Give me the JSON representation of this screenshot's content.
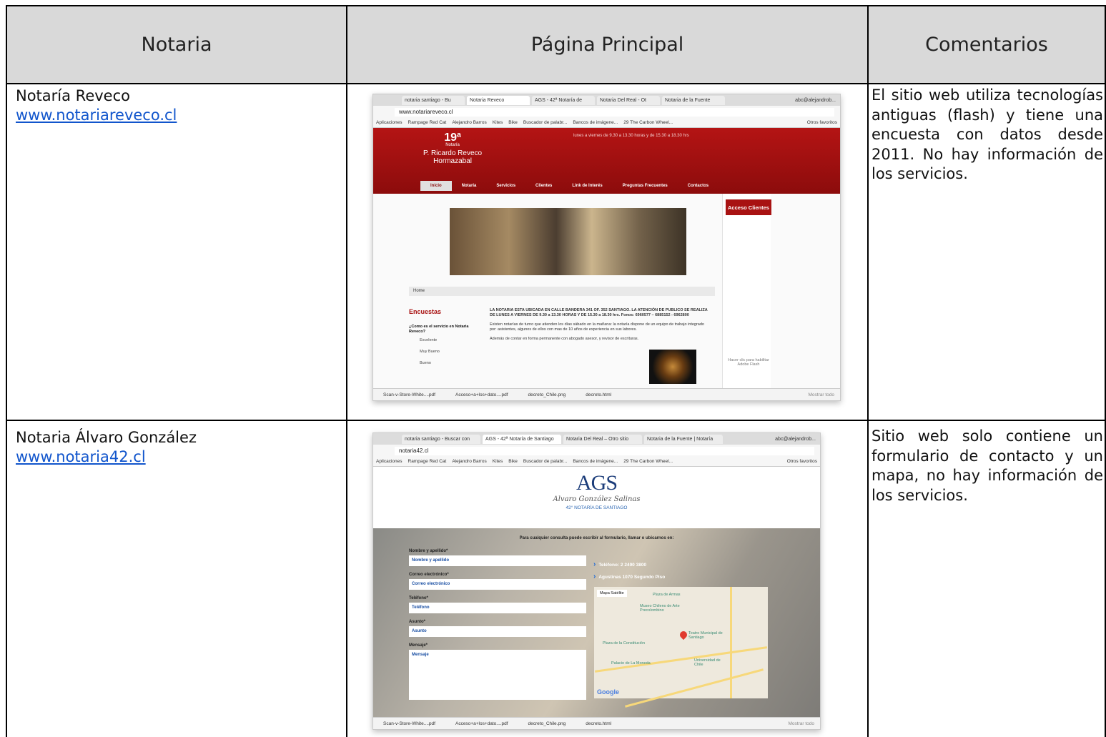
{
  "table": {
    "headers": [
      "Notaria",
      "Página Principal",
      "Comentarios"
    ],
    "rows": [
      {
        "name": "Notaría Reveco",
        "url": "www.notariareveco.cl",
        "comment": "El sitio web utiliza tecnologías antiguas (flash) y tiene una encuesta con datos desde 2011. No hay información de los servicios."
      },
      {
        "name": "Notaria Álvaro González",
        "url": "www.notaria42.cl",
        "comment": "Sitio web solo contiene un formulario de contacto y un mapa, no hay información de los servicios."
      }
    ]
  },
  "shot1": {
    "tabs": [
      "notaria santiago - Bu",
      "Notaria Reveco",
      "AGS - 42ª Notaría de",
      "Notaria Del Real - Ot",
      "Notaria de la Fuente"
    ],
    "user": "abc@alejandrob...",
    "url": "www.notariareveco.cl",
    "bookmarks": [
      "Aplicaciones",
      "Rampage Red Cat",
      "Alejandro Barros",
      "Kites",
      "Bike",
      "Buscador de palabr...",
      "Bancos de imágene...",
      "29 The Carbon Wheel..."
    ],
    "bookmarks_right": "Otros favoritos",
    "logo_num": "19ª",
    "logo_l1": "Notaría",
    "logo_l2": "P. Ricardo Reveco",
    "logo_l3": "Hormazabal",
    "hours": "lunes a viernes de 9.30 a 13.30 horas y de 15.30 a 18.30 hrs",
    "nav": [
      "Inicio",
      "Notaria",
      "Servicios",
      "Clientes",
      "Link de Interés",
      "Preguntas Frecuentes",
      "Contactos"
    ],
    "acceso": "Acceso Clientes",
    "home": "Home",
    "encuestas": "Encuestas",
    "question": "¿Como es el servicio en Notaria Reveco?",
    "options": [
      "Excelente",
      "Muy Bueno",
      "Bueno"
    ],
    "main_p1": "LA NOTARIA ESTA UBICADA EN CALLE BANDERA 341 OF. 352 SANTIAGO. LA ATENCIÓN DE PUBLICO SE REALIZA DE LUNES A VIERNES DE 9.30 a 13.30 HORAS Y DE 15.30 a 18.30 hrs. Fonos: 6960577 – 6885152 - 6962800",
    "main_p2": "Existen notarías de turno que atienden los días sábado en la mañana: la notaría dispone de un equipo de trabajo integrado por: asistentes, algunos de ellos con mas de 10 años de experiencia en sus labores.",
    "main_p3": "Además de contar en forma permanente con abogado asesor, y revisor de escrituras.",
    "flash": "Hacer clic para habilitar Adobe Flash",
    "downloads": [
      "Scan-v-Store-White....pdf",
      "Acceso+a+los+dato....pdf",
      "decreto_Chile.png",
      "decreto.html"
    ],
    "show_all": "Mostrar todo"
  },
  "shot2": {
    "tabs": [
      "notaria santiago - Buscar con",
      "AGS - 42ª Notaría de Santiago",
      "Notaria Del Real – Otro sitio",
      "Notaria de la Fuente | Notaría"
    ],
    "user": "abc@alejandrob...",
    "url": "notaria42.cl",
    "bookmarks": [
      "Aplicaciones",
      "Rampage Red Cat",
      "Alejandro Barros",
      "Kites",
      "Bike",
      "Buscador de palabr...",
      "Bancos de imágene...",
      "29 The Carbon Wheel..."
    ],
    "bookmarks_right": "Otros favoritos",
    "logo": "AGS",
    "script": "Alvaro González Salinas",
    "sub": "42° NOTARÍA DE SANTIAGO",
    "intro": "Para cualquier consulta puede escribir al formulario, llamar o ubicarnos en:",
    "fields": [
      {
        "label": "Nombre y apellido*",
        "placeholder": "Nombre y apellido"
      },
      {
        "label": "Correo electrónico*",
        "placeholder": "Correo electrónico"
      },
      {
        "label": "Teléfono*",
        "placeholder": "Teléfono"
      },
      {
        "label": "Asunto*",
        "placeholder": "Asunto"
      },
      {
        "label": "Mensaje*",
        "placeholder": "Mensaje"
      }
    ],
    "phone": "Teléfono: 2 2490 3800",
    "address": "Agustinas 1070 Segundo Piso",
    "map_tabs": "Mapa   Satélite",
    "map_places": [
      "Plaza de Armas",
      "Museo Chileno de Arte Precolombino",
      "Teatro Municipal de Santiago",
      "Plaza de la Constitución",
      "Palacio de La Moneda",
      "Universidad de Chile"
    ],
    "google": "Google",
    "downloads": [
      "Scan-v-Store-White....pdf",
      "Acceso+a+los+dato....pdf",
      "decreto_Chile.png",
      "decreto.html"
    ],
    "show_all": "Mostrar todo"
  }
}
